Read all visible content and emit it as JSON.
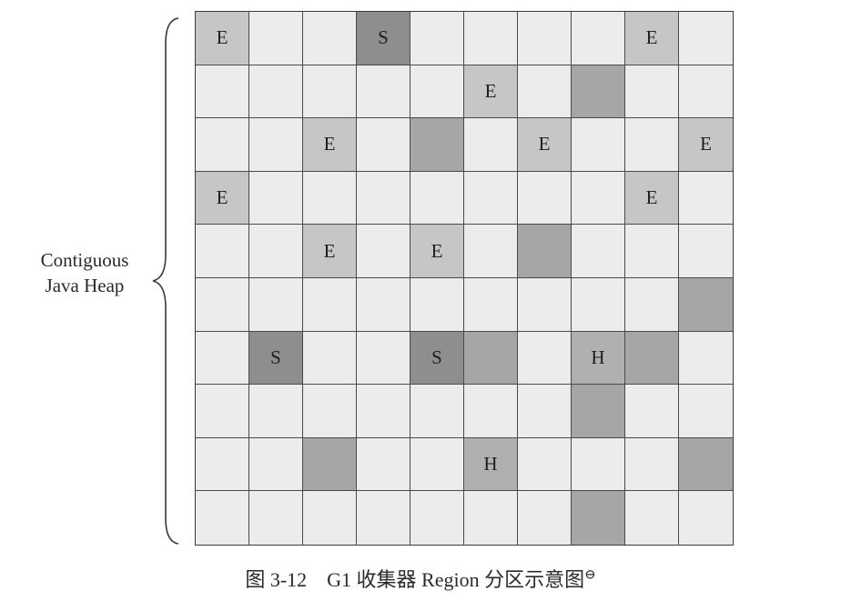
{
  "heap_label": {
    "line1": "Contiguous",
    "line2": "Java Heap"
  },
  "grid": {
    "rows": [
      [
        "E",
        "",
        "",
        "S",
        "",
        "",
        "",
        "",
        "E",
        ""
      ],
      [
        "",
        "",
        "",
        "",
        "",
        "E",
        "",
        "dark",
        "",
        ""
      ],
      [
        "",
        "",
        "E",
        "",
        "dark",
        "",
        "E",
        "",
        "",
        "E"
      ],
      [
        "E",
        "",
        "",
        "",
        "",
        "",
        "",
        "",
        "E",
        ""
      ],
      [
        "",
        "",
        "E",
        "",
        "E",
        "",
        "dark",
        "",
        "",
        ""
      ],
      [
        "",
        "",
        "",
        "",
        "",
        "",
        "",
        "",
        "",
        "dark"
      ],
      [
        "",
        "S",
        "",
        "",
        "S",
        "dark",
        "",
        "H",
        "dark",
        ""
      ],
      [
        "",
        "",
        "",
        "",
        "",
        "",
        "",
        "dark",
        "",
        ""
      ],
      [
        "",
        "",
        "dark",
        "",
        "",
        "H",
        "",
        "",
        "",
        "dark"
      ],
      [
        "",
        "",
        "",
        "",
        "",
        "",
        "",
        "dark",
        "",
        ""
      ]
    ],
    "colors": {
      "free": "#ececec",
      "eden": "#c6c6c6",
      "survivor": "#8e8e8e",
      "humongous": "#b0b0b0",
      "other": "#a6a6a6"
    }
  },
  "caption": {
    "text": "图 3-12　G1 收集器 Region 分区示意图",
    "footnote_mark": "⊖"
  }
}
